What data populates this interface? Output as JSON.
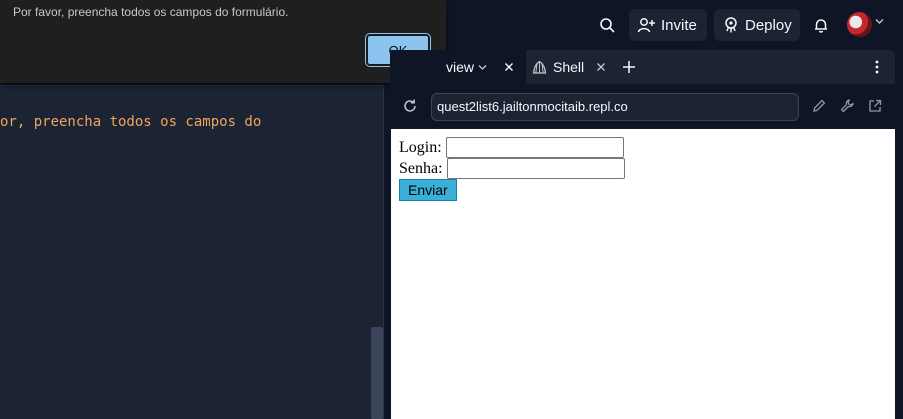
{
  "header": {
    "invite_label": "Invite",
    "deploy_label": "Deploy",
    "icons": [
      "search-icon",
      "add-user-icon",
      "deploy-icon",
      "bell-icon",
      "avatar",
      "chevron-down-icon"
    ]
  },
  "editor": {
    "code_line": "or, preencha todos os campos do"
  },
  "dialog": {
    "message": "Por favor, preencha todos os campos do formulário.",
    "ok_label": "OK"
  },
  "tabs": [
    {
      "label": "view",
      "active": true
    },
    {
      "label": "Shell",
      "active": false
    }
  ],
  "urlbar": {
    "url": "quest2list6.jailtonmocitaib.repl.co"
  },
  "webview": {
    "login_label": "Login:",
    "login_value": "",
    "senha_label": "Senha:",
    "senha_value": "",
    "submit_label": "Enviar"
  },
  "colors": {
    "background": "#0e1525",
    "surface": "#1c2333",
    "code_text": "#f0a45d",
    "ok_button": "#8ac4ef",
    "submit_button": "#39b0d8"
  }
}
